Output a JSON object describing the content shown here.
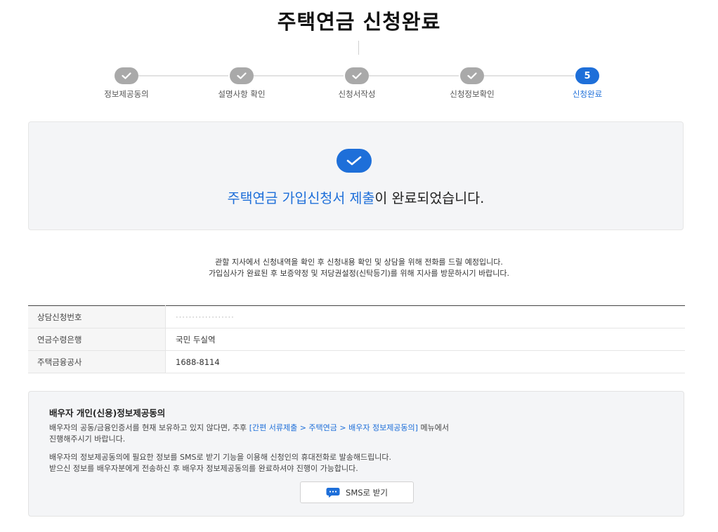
{
  "page_title": "주택연금 신청완료",
  "steps": [
    {
      "label": "정보제공동의",
      "state": "done"
    },
    {
      "label": "설명사항 확인",
      "state": "done"
    },
    {
      "label": "신청서작성",
      "state": "done"
    },
    {
      "label": "신청정보확인",
      "state": "done"
    },
    {
      "label": "신청완료",
      "state": "current",
      "number": "5"
    }
  ],
  "completion": {
    "highlight": "주택연금 가입신청서 제출",
    "rest": "이 완료되었습니다."
  },
  "notice": {
    "line1": "관할 지사에서 신청내역을 확인 후 신청내용 확인 및 상담을 위해 전화를 드릴 예정입니다.",
    "line2": "가입심사가 완료된 후 보증약정 및 저당권설정(신탁등기)를 위해 지사를 방문하시기 바랍니다."
  },
  "info_rows": [
    {
      "label": "상담신청번호",
      "value": "··················"
    },
    {
      "label": "연금수령은행",
      "value": "국민 두실역"
    },
    {
      "label": "주택금융공사",
      "value": "1688-8114"
    }
  ],
  "spouse": {
    "title": "배우자 개인(신용)정보제공동의",
    "p1_pre": "배우자의 공동/금융인증서를 현재 보유하고 있지 않다면, 추후 ",
    "p1_link": "[간편 서류제출 > 주택연금 > 배우자 정보제공동의]",
    "p1_post": " 메뉴에서",
    "p1_line2": "진행해주시기 바랍니다.",
    "p2_line1": "배우자의 정보제공동의에 필요한 정보를 SMS로 받기 기능을 이용해 신청인의 휴대전화로 발송해드립니다.",
    "p2_line2": "받으신 정보를 배우자분에게 전송하신 후 배우자 정보제공동의를 완료하셔야 진행이 가능합니다.",
    "sms_button_label": "SMS로 받기"
  },
  "colors": {
    "accent": "#1e6fd9",
    "step_done": "#a9a9a9",
    "panel_bg": "#f4f5f7"
  }
}
